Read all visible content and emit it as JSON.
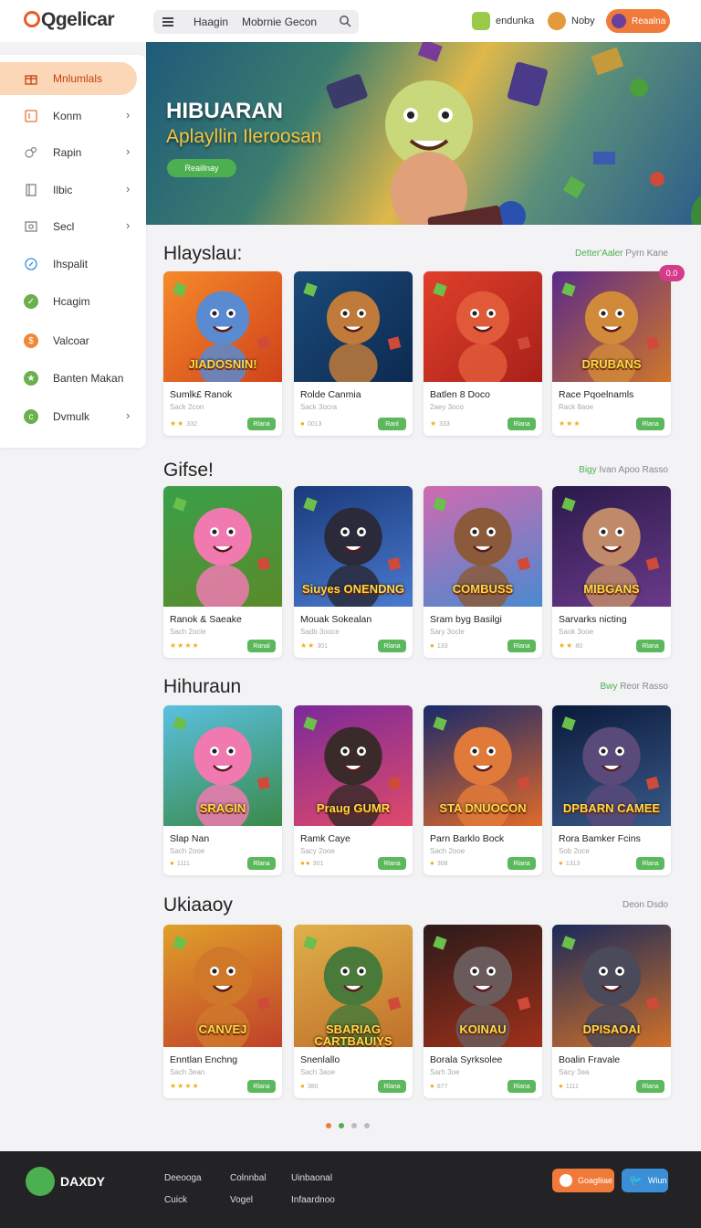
{
  "header": {
    "logo": "Qgelicar",
    "search": {
      "item1": "Haagin",
      "item2": "Mobrnie Gecon"
    },
    "menu1": "endunka",
    "menu2": "Noby",
    "user_button": "Reaalna"
  },
  "sidebar": {
    "items": [
      {
        "label": "Mnlumlals",
        "icon": "gift-icon",
        "active": true,
        "chevron": false
      },
      {
        "label": "Konm",
        "icon": "tag-icon",
        "chevron": true
      },
      {
        "label": "Rapin",
        "icon": "controller-icon",
        "chevron": true
      },
      {
        "label": "Ilbic",
        "icon": "book-icon",
        "chevron": true
      },
      {
        "label": "Secl",
        "icon": "image-icon",
        "chevron": true
      },
      {
        "label": "Ihspalit",
        "icon": "compass-icon",
        "chevron": false
      },
      {
        "label": "Hcagim",
        "icon": "check-circle-icon",
        "chevron": false
      },
      {
        "label": "Valcoar",
        "icon": "coin-icon",
        "chevron": false
      },
      {
        "label": "Banten Makan",
        "icon": "star-circle-icon",
        "chevron": false
      },
      {
        "label": "Dvmulk",
        "icon": "c-circle-icon",
        "chevron": true
      }
    ]
  },
  "hero": {
    "title": "HIBUARAN",
    "subtitle": "Aplayllin Ileroosan",
    "button": "Reaillnay"
  },
  "sections": [
    {
      "title": "Hlayslau:",
      "link_accent": "Detter'Aaler",
      "link": "Pyrn Kane",
      "badge": "0.0",
      "cards": [
        {
          "thumb_title": "JIADOSNIN!",
          "name": "Sumlk£ Ranok",
          "sub": "Sack 2con",
          "rating": "★★",
          "meta": "332",
          "button": "Rlana"
        },
        {
          "thumb_title": "",
          "name": "Rolde Canmia",
          "sub": "Sack 3ocra",
          "rating": "●",
          "meta": "0013",
          "button": "Ranl"
        },
        {
          "thumb_title": "",
          "name": "Batlen 8 Doco",
          "sub": "2aey 3oco",
          "rating": "★",
          "meta": "333",
          "button": "Rlana"
        },
        {
          "thumb_title": "DRUBANS",
          "name": "Race Pqoelnamls",
          "sub": "Rack 8aoe",
          "rating": "★★★",
          "meta": "",
          "button": "Rlana"
        }
      ]
    },
    {
      "title": "Gifse!",
      "link_accent": "Bigy",
      "link": "Ivan Apoo Rasso",
      "cards": [
        {
          "thumb_title": "",
          "name": "Ranok & Saeake",
          "sub": "Sach 2ocle",
          "rating": "★★★★",
          "meta": "",
          "button": "Ranal"
        },
        {
          "thumb_title": "Siuyes ONENDNG",
          "name": "Mouak Sokealan",
          "sub": "Sadb 3ooce",
          "rating": "★★",
          "meta": "301",
          "button": "Rlana"
        },
        {
          "thumb_title": "COMBUSS",
          "name": "Sram byg Basilgi",
          "sub": "Sary 3ocle",
          "rating": "●",
          "meta": "133",
          "button": "Rlana"
        },
        {
          "thumb_title": "MIBGANS",
          "name": "Sarvarks nicting",
          "sub": "Saok 3ooe",
          "rating": "★★",
          "meta": "80",
          "button": "Rlana"
        }
      ]
    },
    {
      "title": "Hihuraun",
      "link_accent": "Bwy",
      "link": "Reor Rasso",
      "cards": [
        {
          "thumb_title": "SRAGIN",
          "name": "Slap Nan",
          "sub": "Sach 2ooe",
          "rating": "●",
          "meta": "1111",
          "button": "Rlana"
        },
        {
          "thumb_title": "Praug GUMR",
          "name": "Ramk Caye",
          "sub": "Sacy 2ooe",
          "rating": "●●",
          "meta": "301",
          "button": "Rlana"
        },
        {
          "thumb_title": "STA DNUOCON",
          "name": "Parn Barklo Bock",
          "sub": "Sach 2ooe",
          "rating": "●",
          "meta": "308",
          "button": "Rlana"
        },
        {
          "thumb_title": "DPBARN CAMEE",
          "name": "Rora Bamker Fcins",
          "sub": "Sob 2oce",
          "rating": "●",
          "meta": "1313",
          "button": "Rlana"
        }
      ]
    },
    {
      "title": "Ukiaaoy",
      "link_accent": "",
      "link": "Deon Dsdo",
      "cards": [
        {
          "thumb_title": "CANVEJ",
          "name": "Enntlan Enchng",
          "sub": "Sach 3ean",
          "rating": "★★★★",
          "meta": "",
          "button": "Rlana"
        },
        {
          "thumb_title": "SBARIAG CARTBAUIYS",
          "name": "Snenlallo",
          "sub": "Sach 3aoe",
          "rating": "●",
          "meta": "380",
          "button": "Rlana"
        },
        {
          "thumb_title": "KOINAU",
          "name": "Borala Syrksolee",
          "sub": "Sarh 3oe",
          "rating": "●",
          "meta": "877",
          "button": "Rlana"
        },
        {
          "thumb_title": "DPISAOAI",
          "name": "Boalin Fravale",
          "sub": "Sacy 3ea",
          "rating": "●",
          "meta": "1111",
          "button": "Rlana"
        }
      ]
    }
  ],
  "footer": {
    "logo": "DAXDY",
    "links": [
      "Deeooga",
      "Colnnbal",
      "Uinbaonal",
      "Cuick",
      "Vogel",
      "Infaardnoo"
    ],
    "social1": "Goagliiae",
    "social2": "Wiun"
  },
  "colors": {
    "accent": "#f07a3a",
    "green": "#5cb85c",
    "footer": "#232325",
    "active_bg": "#fbd7b8"
  }
}
